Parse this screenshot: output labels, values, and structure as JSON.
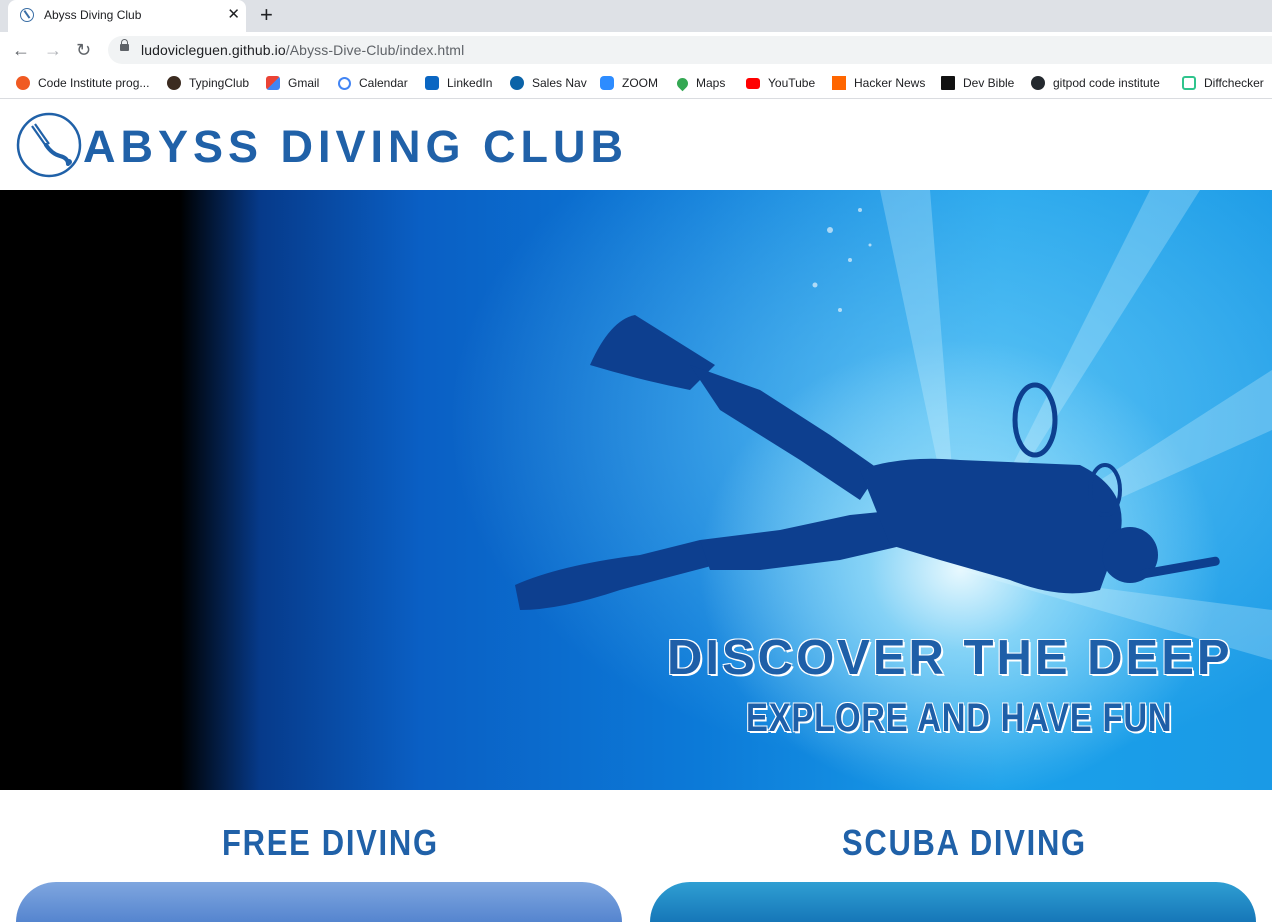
{
  "browser": {
    "tab_title": "Abyss Diving Club",
    "tab_close": "✕",
    "new_tab": "+",
    "nav": {
      "back": "←",
      "forward": "→",
      "reload": "↻"
    },
    "url_host": "ludovicleguen.github.io",
    "url_path": "/Abyss-Dive-Club/index.html",
    "bookmarks": [
      {
        "label": "Code Institute prog...",
        "icon": "code-institute-icon",
        "color": "#f05a22"
      },
      {
        "label": "TypingClub",
        "icon": "typingclub-icon",
        "color": "#3b2b20"
      },
      {
        "label": "Gmail",
        "icon": "gmail-icon",
        "color": "#ea4335"
      },
      {
        "label": "Calendar",
        "icon": "google-icon",
        "color": "#4285f4"
      },
      {
        "label": "LinkedIn",
        "icon": "linkedin-icon",
        "color": "#0a66c2"
      },
      {
        "label": "Sales Nav",
        "icon": "sales-nav-icon",
        "color": "#0b63a8"
      },
      {
        "label": "ZOOM",
        "icon": "zoom-icon",
        "color": "#2d8cff"
      },
      {
        "label": "Maps",
        "icon": "maps-icon",
        "color": "#34a853"
      },
      {
        "label": "YouTube",
        "icon": "youtube-icon",
        "color": "#ff0000"
      },
      {
        "label": "Hacker News",
        "icon": "hacker-news-icon",
        "color": "#ff6600"
      },
      {
        "label": "Dev Bible",
        "icon": "dev-bible-icon",
        "color": "#111111"
      },
      {
        "label": "gitpod code institute",
        "icon": "github-icon",
        "color": "#24292e"
      },
      {
        "label": "Diffchecker",
        "icon": "diffchecker-icon",
        "color": "#2fc48d"
      }
    ]
  },
  "site": {
    "title": "ABYSS DIVING CLUB",
    "brand_color": "#2061a8",
    "hero": {
      "heading": "DISCOVER THE DEEP",
      "subheading": "EXPLORE AND HAVE FUN"
    },
    "sections": [
      {
        "title": "FREE DIVING"
      },
      {
        "title": "SCUBA DIVING"
      }
    ]
  }
}
